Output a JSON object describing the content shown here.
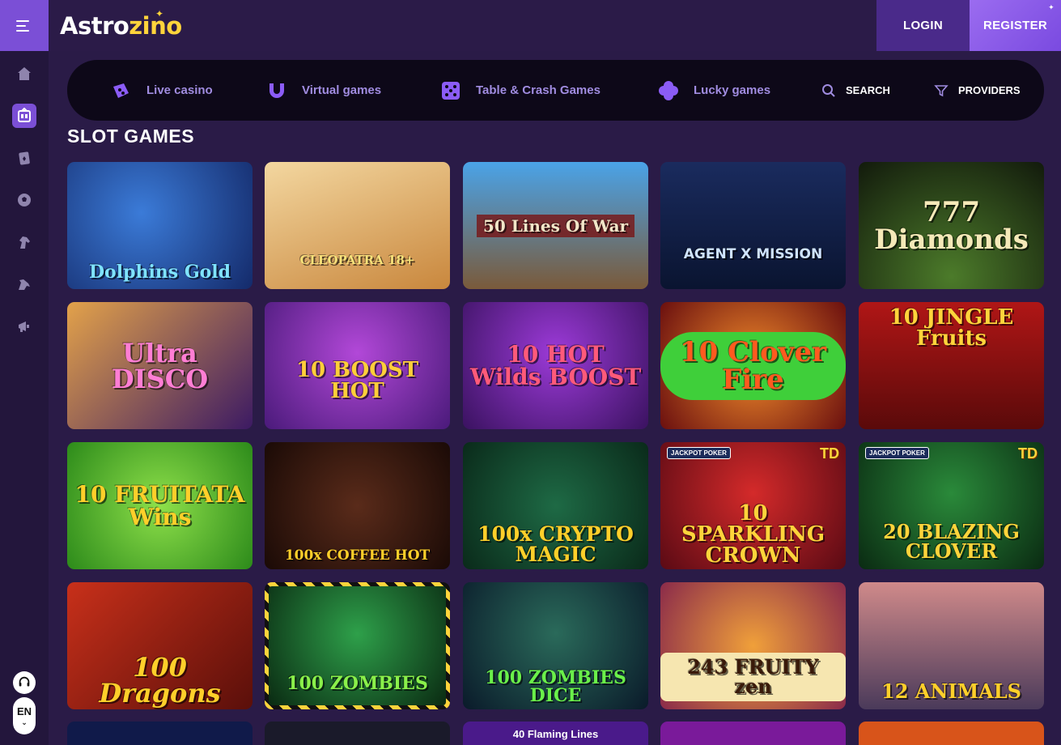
{
  "header": {
    "logo_part1": "Astro",
    "logo_part2": "zino",
    "login_label": "LOGIN",
    "register_label": "REGISTER"
  },
  "sidebar": {
    "items": [
      {
        "icon": "home-icon"
      },
      {
        "icon": "slots-icon",
        "active": true
      },
      {
        "icon": "cards-icon"
      },
      {
        "icon": "football-icon"
      },
      {
        "icon": "horse-icon"
      },
      {
        "icon": "greyhound-icon"
      },
      {
        "icon": "megaphone-icon"
      }
    ],
    "language": "EN"
  },
  "categories": {
    "live_casino": "Live casino",
    "virtual_games": "Virtual games",
    "table_crash": "Table & Crash Games",
    "lucky_games": "Lucky games",
    "search": "SEARCH",
    "providers": "PROVIDERS"
  },
  "section_title": "SLOT GAMES",
  "games": [
    {
      "title": "Dolphins Gold"
    },
    {
      "title": "CLEOPATRA 18+"
    },
    {
      "title": "50 Lines Of War"
    },
    {
      "title": "AGENT X MISSION"
    },
    {
      "title": "777 Diamonds"
    },
    {
      "title": "Ultra DISCO"
    },
    {
      "title": "10 BOOST HOT"
    },
    {
      "title": "10 HOT Wilds BOOST"
    },
    {
      "title": "10 Clover Fire"
    },
    {
      "title": "10 JINGLE Fruits"
    },
    {
      "title": "10 FRUITATA Wins"
    },
    {
      "title": "100x COFFEE HOT"
    },
    {
      "title": "100x CRYPTO MAGIC"
    },
    {
      "title": "10 SPARKLING CROWN",
      "badge": "TD",
      "jackpot": "JACKPOT POKER"
    },
    {
      "title": "20 BLAZING CLOVER",
      "badge": "TD",
      "jackpot": "JACKPOT POKER"
    },
    {
      "title": "100 Dragons"
    },
    {
      "title": "100 ZOMBIES"
    },
    {
      "title": "100 ZOMBIES DICE"
    },
    {
      "title": "243 FRUITY zen"
    },
    {
      "title": "12 ANIMALS"
    },
    {
      "title": ""
    },
    {
      "title": ""
    },
    {
      "title": "40 Flaming Lines"
    },
    {
      "title": ""
    },
    {
      "title": ""
    }
  ],
  "colors": {
    "accent": "#7b4fd6",
    "background": "#2a1b47",
    "nav_bg": "#0d0818",
    "logo_yellow": "#ffd43b"
  }
}
